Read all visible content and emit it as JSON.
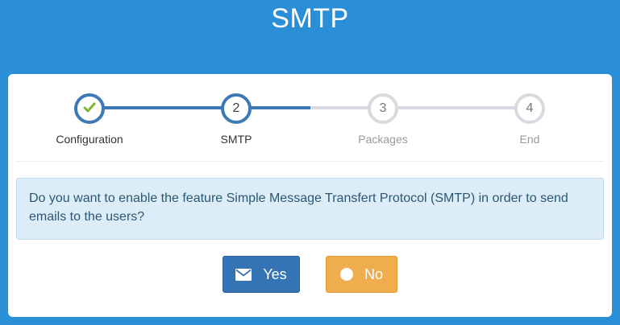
{
  "header": {
    "title": "SMTP"
  },
  "wizard": {
    "steps": [
      {
        "number": "",
        "icon": "checkmark-icon",
        "label": "Configuration",
        "state": "done"
      },
      {
        "number": "2",
        "label": "SMTP",
        "state": "active"
      },
      {
        "number": "3",
        "label": "Packages",
        "state": "pending"
      },
      {
        "number": "4",
        "label": "End",
        "state": "pending"
      }
    ],
    "progress_fraction": 0.5
  },
  "alert": {
    "message": "Do you want to enable the feature Simple Message Transfert Protocol (SMTP) in order to send emails to the users?"
  },
  "actions": {
    "yes_label": "Yes",
    "yes_icon": "envelope-icon",
    "no_label": "No",
    "no_icon": "circle-icon"
  },
  "colors": {
    "background": "#2a8fd6",
    "accent": "#3d7ab5",
    "yes_button": "#3574b4",
    "no_button": "#f0ad4e",
    "check": "#7ab52e"
  }
}
